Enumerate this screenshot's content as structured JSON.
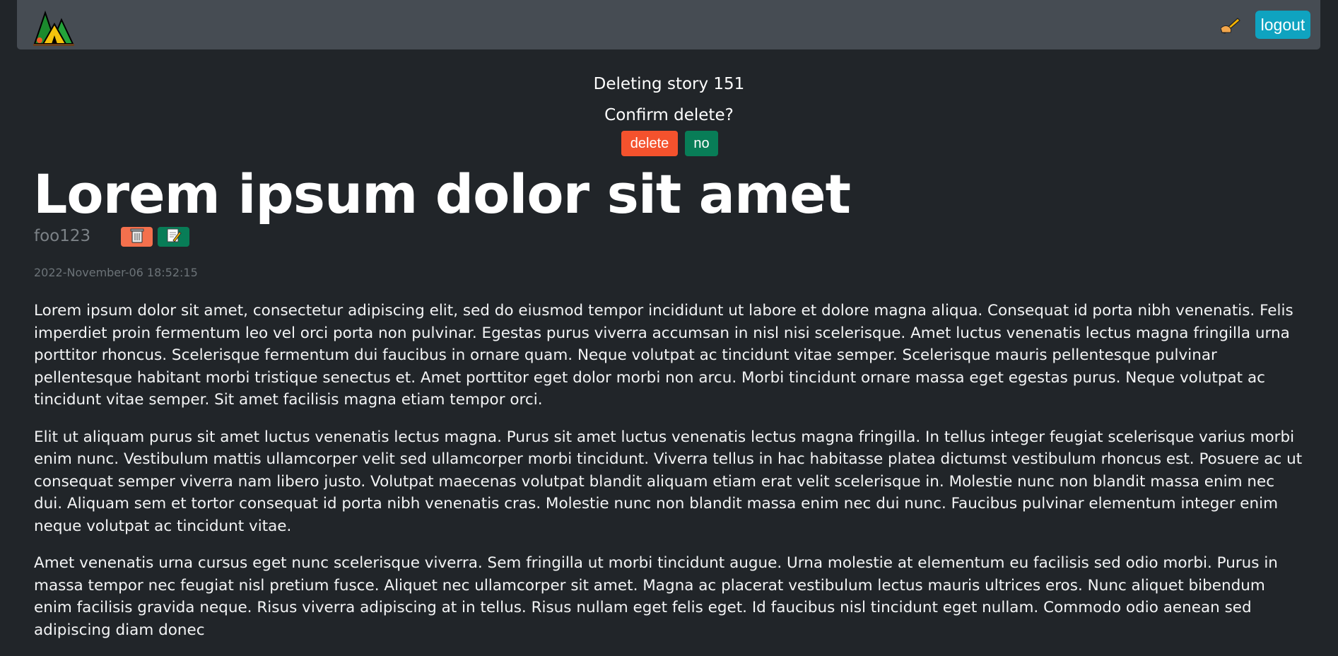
{
  "navbar": {
    "logo_icon": "campsite-icon",
    "new_story_icon": "writing-hand-icon",
    "logout_label": "logout"
  },
  "confirm": {
    "deleting_text": "Deleting story 151",
    "question": "Confirm delete?",
    "delete_label": "delete",
    "no_label": "no",
    "delete_color": "#f4522d",
    "no_color": "#087d57"
  },
  "story": {
    "title": "Lorem ipsum dolor sit amet",
    "author": "foo123",
    "trash_icon": "wastebasket-icon",
    "edit_icon": "memo-icon",
    "timestamp": "2022-November-06 18:52:15",
    "paragraphs": [
      "Lorem ipsum dolor sit amet, consectetur adipiscing elit, sed do eiusmod tempor incididunt ut labore et dolore magna aliqua. Consequat id porta nibh venenatis. Felis imperdiet proin fermentum leo vel orci porta non pulvinar. Egestas purus viverra accumsan in nisl nisi scelerisque. Amet luctus venenatis lectus magna fringilla urna porttitor rhoncus. Scelerisque fermentum dui faucibus in ornare quam. Neque volutpat ac tincidunt vitae semper. Scelerisque mauris pellentesque pulvinar pellentesque habitant morbi tristique senectus et. Amet porttitor eget dolor morbi non arcu. Morbi tincidunt ornare massa eget egestas purus. Neque volutpat ac tincidunt vitae semper. Sit amet facilisis magna etiam tempor orci.",
      "Elit ut aliquam purus sit amet luctus venenatis lectus magna. Purus sit amet luctus venenatis lectus magna fringilla. In tellus integer feugiat scelerisque varius morbi enim nunc. Vestibulum mattis ullamcorper velit sed ullamcorper morbi tincidunt. Viverra tellus in hac habitasse platea dictumst vestibulum rhoncus est. Posuere ac ut consequat semper viverra nam libero justo. Volutpat maecenas volutpat blandit aliquam etiam erat velit scelerisque in. Molestie nunc non blandit massa enim nec dui. Aliquam sem et tortor consequat id porta nibh venenatis cras. Molestie nunc non blandit massa enim nec dui nunc. Faucibus pulvinar elementum integer enim neque volutpat ac tincidunt vitae.",
      "Amet venenatis urna cursus eget nunc scelerisque viverra. Sem fringilla ut morbi tincidunt augue. Urna molestie at elementum eu facilisis sed odio morbi. Purus in massa tempor nec feugiat nisl pretium fusce. Aliquet nec ullamcorper sit amet. Magna ac placerat vestibulum lectus mauris ultrices eros. Nunc aliquet bibendum enim facilisis gravida neque. Risus viverra adipiscing at in tellus. Risus nullam eget felis eget. Id faucibus nisl tincidunt eget nullam. Commodo odio aenean sed adipiscing diam donec"
    ]
  }
}
